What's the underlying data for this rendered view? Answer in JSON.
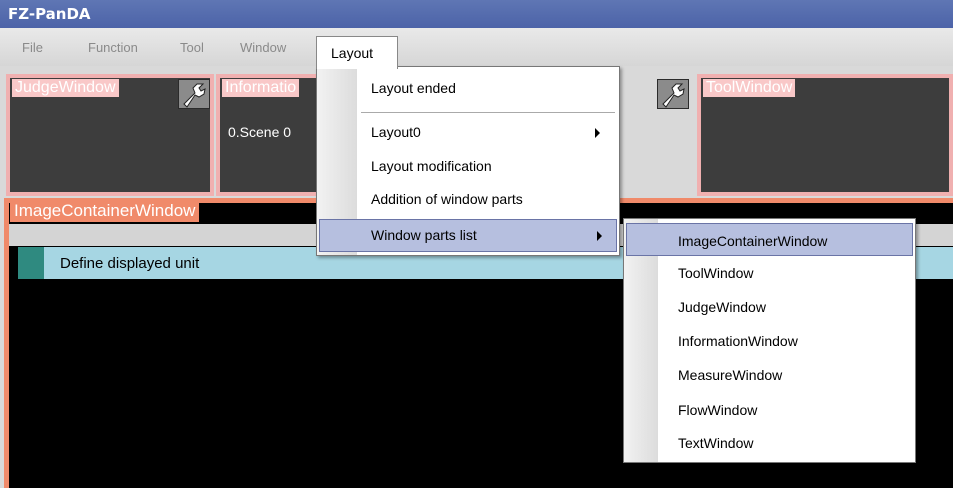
{
  "window": {
    "title": "FZ-PanDA"
  },
  "menubar": {
    "items": [
      "File",
      "Function",
      "Tool",
      "Window"
    ],
    "active": "Layout"
  },
  "panels": {
    "judge": "JudgeWindow",
    "information": "Informatio",
    "information_scene": "0.Scene 0",
    "tool": "ToolWindow",
    "image_container": "ImageContainerWindow",
    "unit_label": "Define displayed unit"
  },
  "layout_menu": {
    "items": [
      "Layout ended",
      "Layout0",
      "Layout modification",
      "Addition of window parts",
      "Window parts list"
    ]
  },
  "window_parts_submenu": {
    "items": [
      "ImageContainerWindow",
      "ToolWindow",
      "JudgeWindow",
      "InformationWindow",
      "MeasureWindow",
      "FlowWindow",
      "TextWindow"
    ]
  },
  "icons": [
    "wrench-icon",
    "submenu-arrow-icon"
  ]
}
